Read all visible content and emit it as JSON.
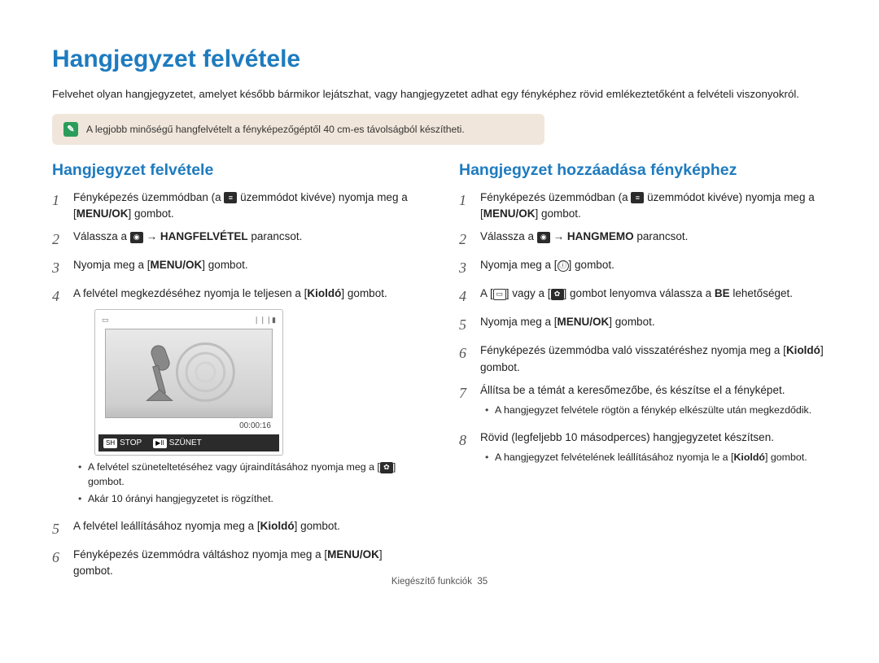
{
  "title": "Hangjegyzet felvétele",
  "intro": "Felvehet olyan hangjegyzetet, amelyet később bármikor lejátszhat, vagy hangjegyzetet adhat egy fényképhez rövid emlékeztetőként a felvételi viszonyokról.",
  "tip": "A legjobb minőségű hangfelvételt a fényképezőgéptől 40 cm-es távolságból készítheti.",
  "left": {
    "heading": "Hangjegyzet felvétele",
    "step1_a": "Fényképezés üzemmódban (a ",
    "step1_b": " üzemmódot kivéve) nyomja meg a [",
    "step1_c": "] gombot.",
    "menuok": "MENU/OK",
    "step2_a": "Válassza a ",
    "step2_b": " → ",
    "step2_bold": "HANGFELVÉTEL",
    "step2_c": " parancsot.",
    "step3_a": "Nyomja meg a [",
    "step3_b": "] gombot.",
    "step4_a": "A felvétel megkezdéséhez nyomja le teljesen a [",
    "step4_bold": "Kioldó",
    "step4_b": "] gombot.",
    "timecode": "00:00:16",
    "ctrl_stop": "STOP",
    "ctrl_pause": "SZÜNET",
    "bullet1_a": "A felvétel szüneteltetéséhez vagy újraindításához nyomja meg a [",
    "bullet1_b": "] gombot.",
    "bullet2": "Akár 10 órányi hangjegyzetet is rögzíthet.",
    "step5_a": "A felvétel leállításához nyomja meg a [",
    "step5_bold": "Kioldó",
    "step5_b": "] gombot.",
    "step6_a": "Fényképezés üzemmódra váltáshoz nyomja meg a [",
    "step6_b": "] gombot."
  },
  "right": {
    "heading": "Hangjegyzet hozzáadása fényképhez",
    "menuok": "MENU/OK",
    "step1_a": "Fényképezés üzemmódban (a ",
    "step1_b": " üzemmódot kivéve) nyomja meg a [",
    "step1_c": "] gombot.",
    "step2_a": "Válassza a ",
    "step2_arrow": " → ",
    "step2_bold": "HANGMEMO",
    "step2_c": " parancsot.",
    "step3_a": "Nyomja meg a [",
    "step3_b": "] gombot.",
    "step4_a": "A [",
    "step4_b": "] vagy a [",
    "step4_c": "] gombot lenyomva válassza a ",
    "step4_bold": "BE",
    "step4_d": " lehetőséget.",
    "step5_a": "Nyomja meg a [",
    "step5_b": "] gombot.",
    "step6_a": "Fényképezés üzemmódba való visszatéréshez nyomja meg a [",
    "step6_bold": "Kioldó",
    "step6_b": "] gombot.",
    "step7": "Állítsa be a témát a keresőmezőbe, és készítse el a fényképet.",
    "bullet7": "A hangjegyzet felvétele rögtön a fénykép elkészülte után megkezdődik.",
    "step8": "Rövid (legfeljebb 10 másodperces) hangjegyzetet készítsen.",
    "bullet8_a": "A hangjegyzet felvételének leállításához nyomja le a [",
    "bullet8_bold": "Kioldó",
    "bullet8_b": "] gombot."
  },
  "footer_a": "Kiegészítő funkciók",
  "footer_b": "35"
}
